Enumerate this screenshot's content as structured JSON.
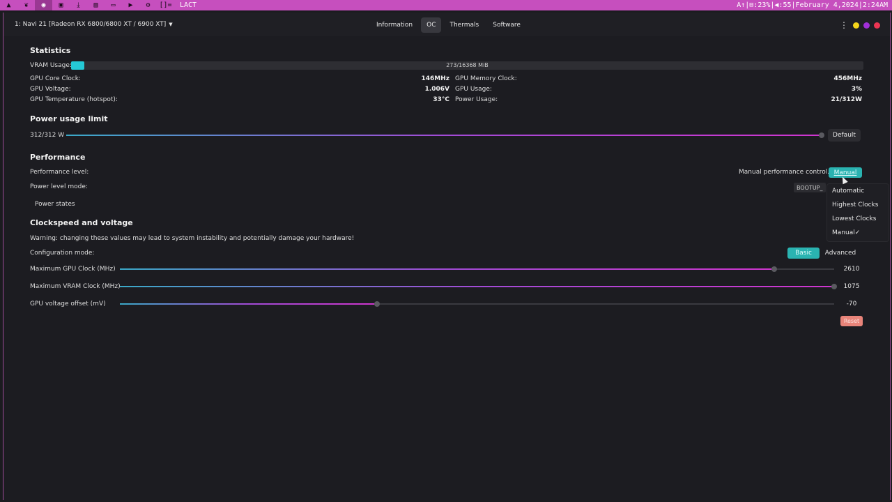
{
  "panel": {
    "icons": [
      "arch-icon",
      "leaf-icon",
      "firefox-icon",
      "terminal-icon",
      "download-icon",
      "file-icon",
      "folder-icon",
      "video-icon",
      "settings-icon",
      "layout-icon"
    ],
    "layout_glyph": "[]=",
    "window_title": "LACT",
    "status": "A↑|⊟:23%|◀:55|February 4,2024|2:24AM"
  },
  "header": {
    "gpu_select": "1: Navi 21 [Radeon RX 6800/6800 XT / 6900 XT]",
    "tabs": [
      {
        "label": "Information"
      },
      {
        "label": "OC"
      },
      {
        "label": "Thermals"
      },
      {
        "label": "Software"
      }
    ],
    "active_tab": "OC"
  },
  "statistics": {
    "title": "Statistics",
    "vram_label": "VRAM Usage:",
    "vram_text": "273/16368 MiB",
    "vram_fraction": 0.0167,
    "rows_left": [
      {
        "label": "GPU Core Clock:",
        "value": "146MHz"
      },
      {
        "label": "GPU Voltage:",
        "value": "1.006V"
      },
      {
        "label": "GPU Temperature (hotspot):",
        "value": "33°C"
      }
    ],
    "rows_right": [
      {
        "label": "GPU Memory Clock:",
        "value": "456MHz"
      },
      {
        "label": "GPU Usage:",
        "value": "3%"
      },
      {
        "label": "Power Usage:",
        "value": "21/312W"
      }
    ]
  },
  "power_limit": {
    "title": "Power usage limit",
    "value_text": "312/312 W",
    "fraction": 1.0,
    "default_button": "Default"
  },
  "performance": {
    "title": "Performance",
    "level_label": "Performance level:",
    "manual_control_label": "Manual performance control.",
    "dropdown_value": "Manual",
    "mode_label": "Power level mode:",
    "mode_value": "BOOTUP_",
    "power_states": "Power states",
    "options": [
      "Automatic",
      "Highest Clocks",
      "Lowest Clocks",
      "Manual"
    ],
    "selected_option": "Manual",
    "check": "✓"
  },
  "clockspeed": {
    "title": "Clockspeed and voltage",
    "warning": "Warning: changing these values may lead to system instability and potentially damage your hardware!",
    "config_label": "Configuration mode:",
    "basic": "Basic",
    "advanced": "Advanced",
    "sliders": [
      {
        "label": "Maximum GPU Clock (MHz)",
        "value": "2610",
        "fraction": 0.916
      },
      {
        "label": "Maximum VRAM Clock (MHz)",
        "value": "1075",
        "fraction": 1.0
      },
      {
        "label": "GPU voltage offset (mV)",
        "value": "-70",
        "fraction": 0.36
      }
    ],
    "reset": "Reset"
  },
  "colors": {
    "accent": "#2ab3b1",
    "panel": "#c64fbe",
    "reset": "#e8847a"
  }
}
